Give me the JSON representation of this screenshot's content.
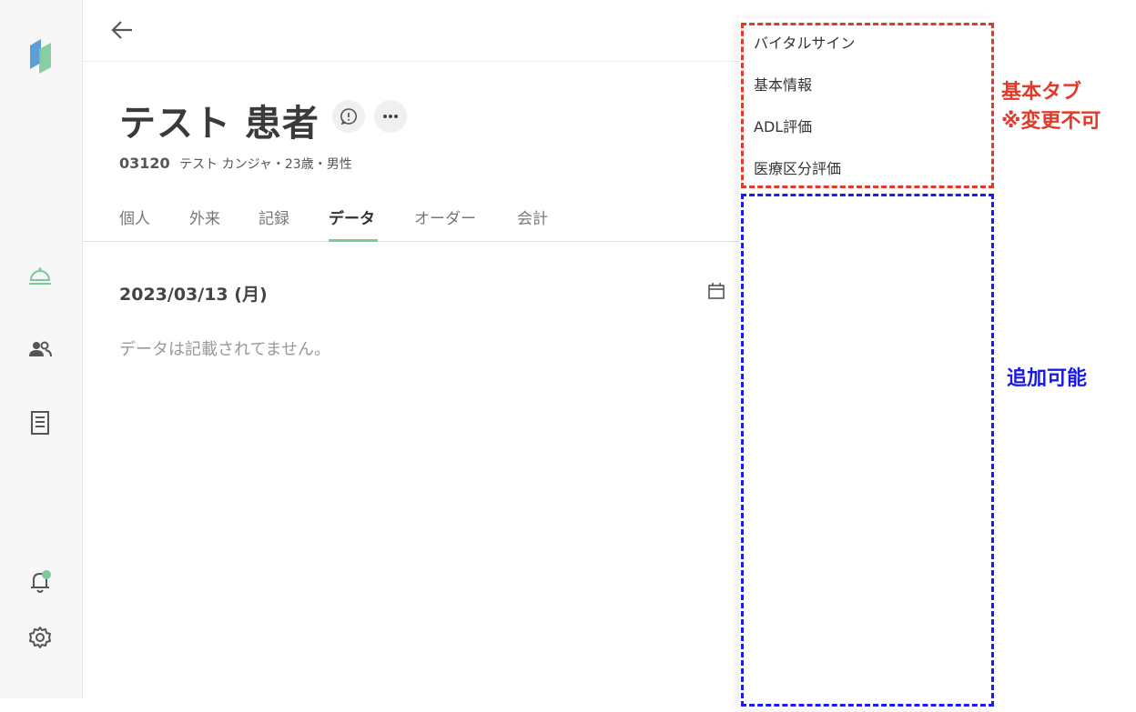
{
  "patient": {
    "name": "テスト 患者",
    "id": "03120",
    "detail": "テスト カンジャ・23歳・男性"
  },
  "tabs": [
    "個人",
    "外来",
    "記録",
    "データ",
    "オーダー",
    "会計"
  ],
  "active_tab": "データ",
  "content": {
    "date": "2023/03/13 (月)",
    "empty_message": "データは記載されてません。"
  },
  "dropdown": {
    "items": [
      "バイタルサイン",
      "基本情報",
      "ADL評価",
      "医療区分評価"
    ]
  },
  "annotations": {
    "red_line1": "基本タブ",
    "red_line2": "※変更不可",
    "blue": "追加可能"
  },
  "icons": {
    "logo": "app-logo",
    "rail": [
      "dome-cloche-icon",
      "people-icon",
      "receipt-icon",
      "bell-icon",
      "gear-icon"
    ],
    "back": "back-arrow-icon",
    "alert": "alert-bubble-icon",
    "more": "more-horizontal-icon",
    "calendar": "calendar-icon"
  },
  "colors": {
    "accent_green": "#7cc89a",
    "annotation_red": "#e03a2a",
    "annotation_blue": "#1a1ae0"
  }
}
